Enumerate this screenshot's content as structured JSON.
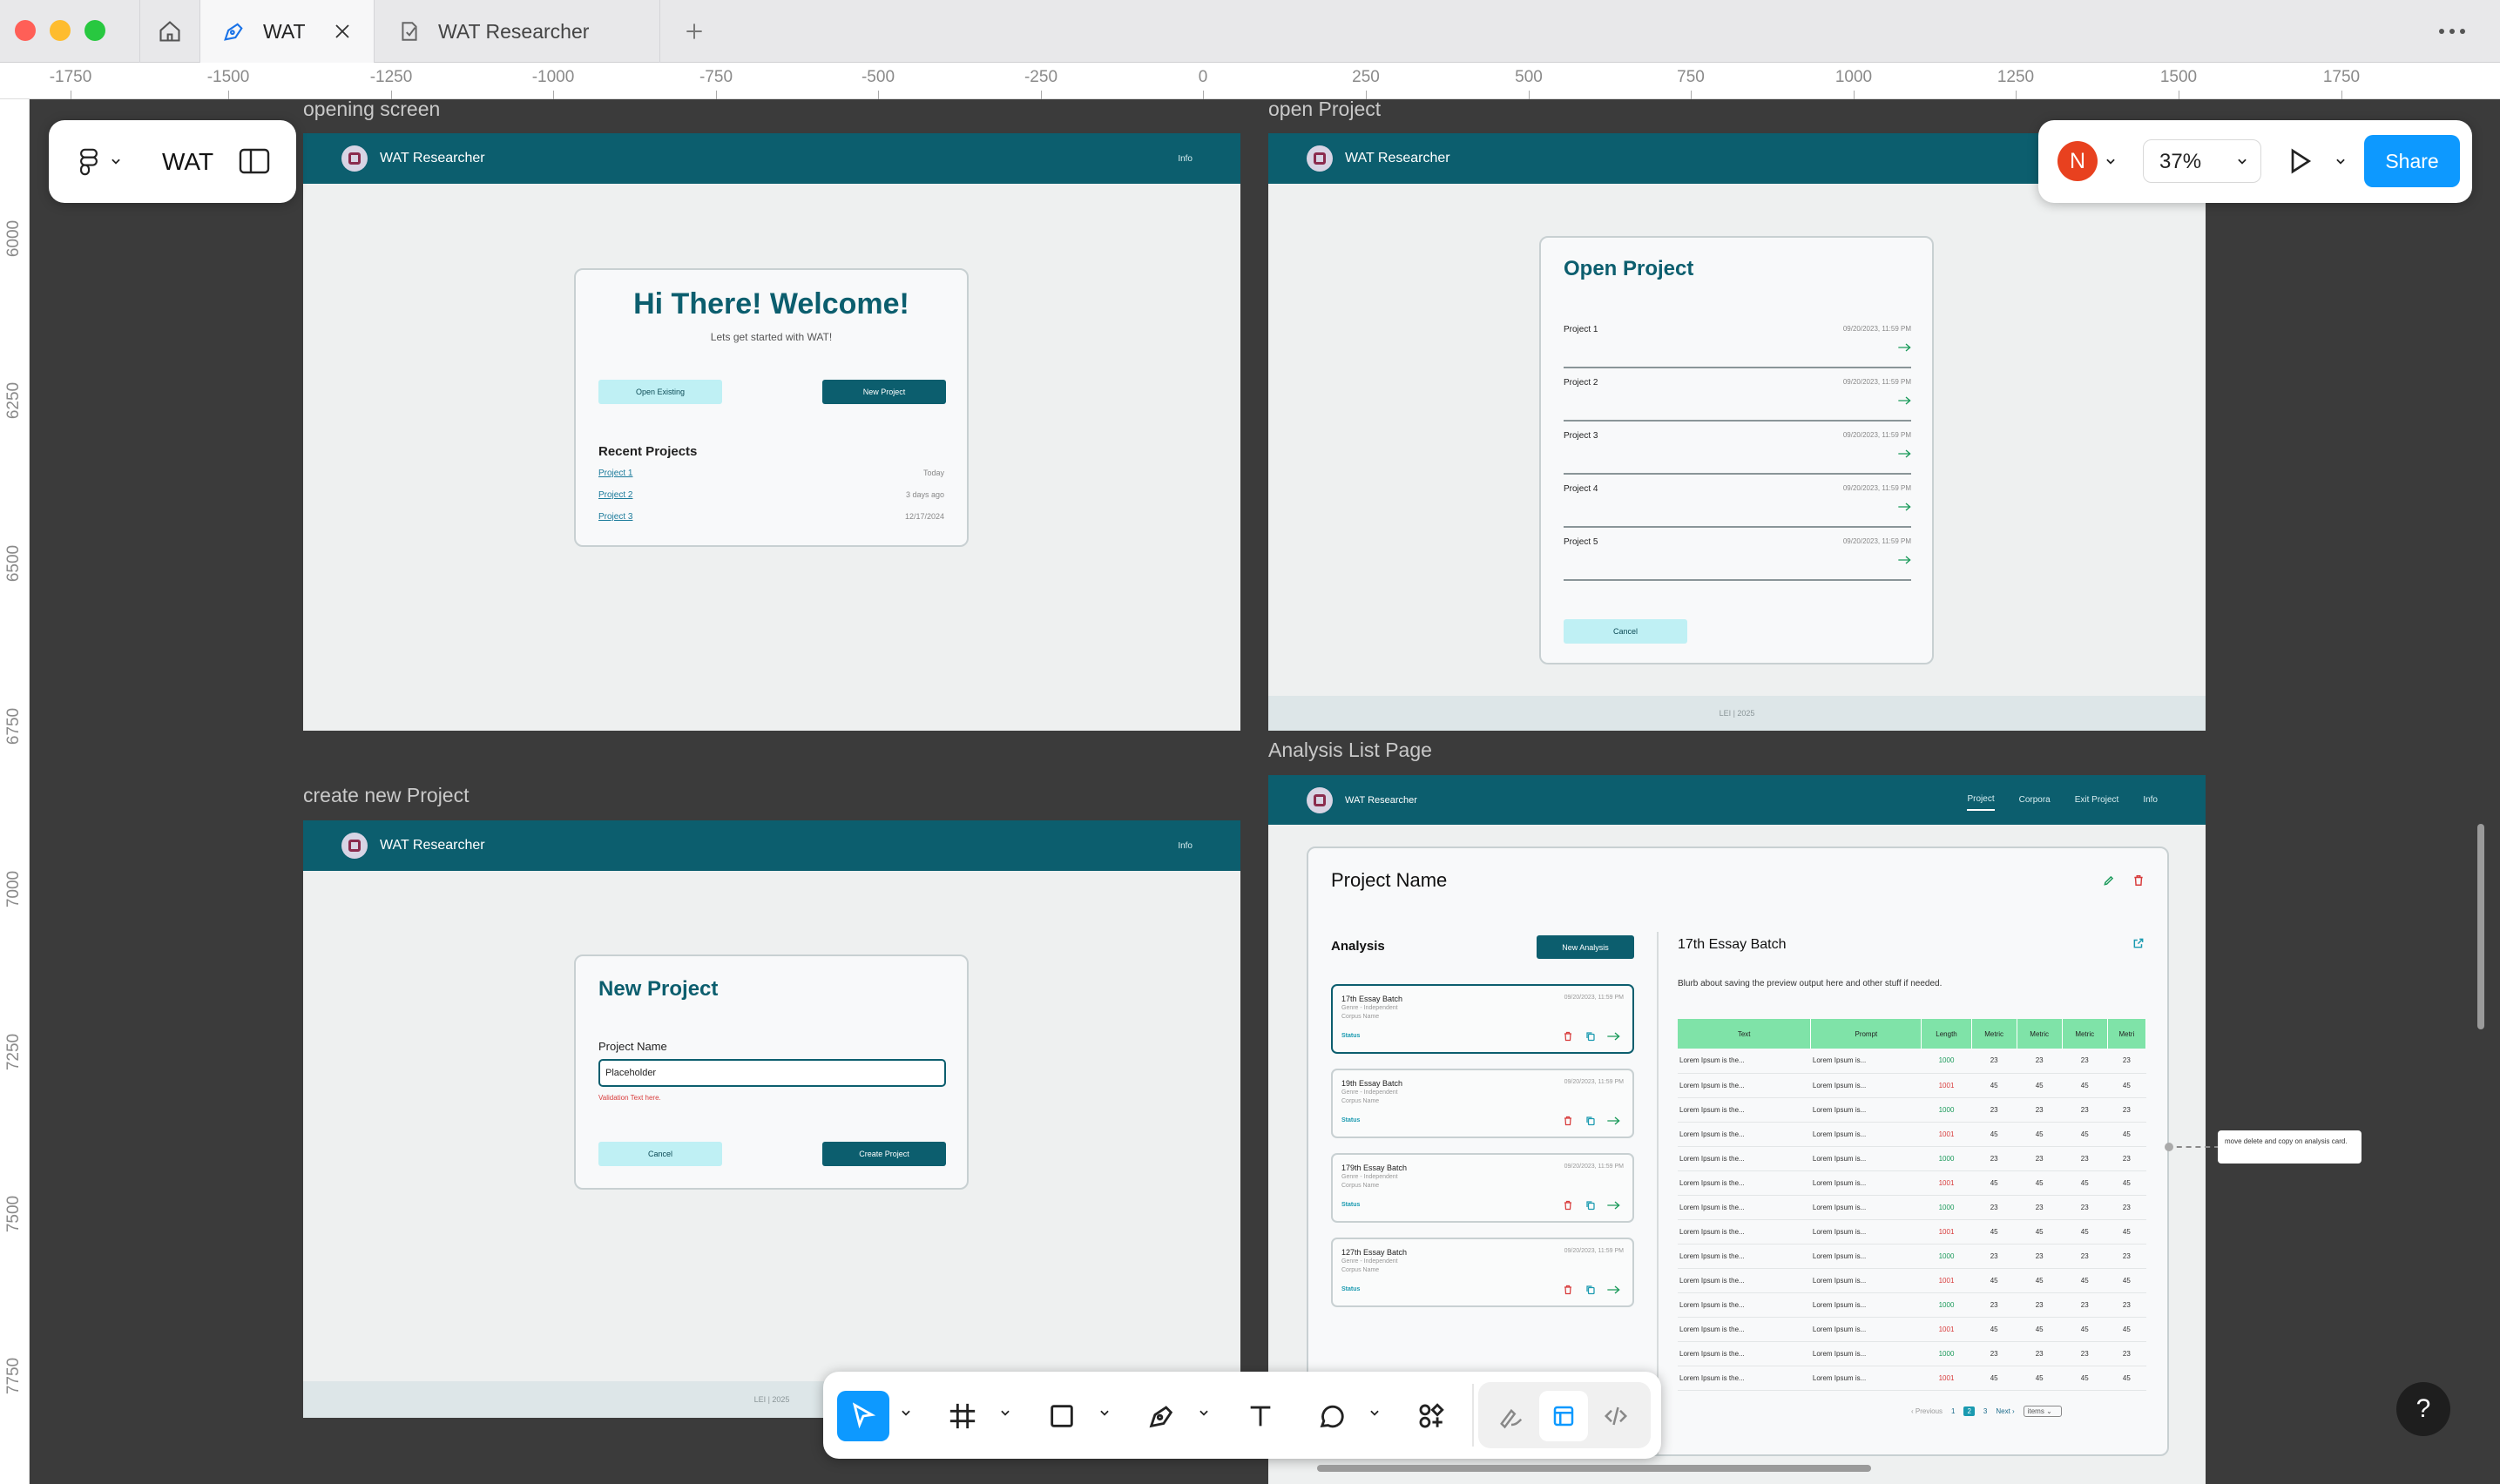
{
  "tabs": [
    {
      "label": "WAT",
      "active": true
    },
    {
      "label": "WAT Researcher",
      "active": false
    }
  ],
  "ruler": {
    "horizontal": [
      "-1750",
      "-1500",
      "-1250",
      "-1000",
      "-750",
      "-500",
      "-250",
      "0",
      "250",
      "500",
      "750",
      "1000",
      "1250",
      "1500",
      "1750"
    ],
    "vertical": [
      "6000",
      "6250",
      "6500",
      "6750",
      "7000",
      "7250",
      "7500",
      "7750"
    ]
  },
  "file": {
    "name": "WAT"
  },
  "share": {
    "avatar_initial": "N",
    "zoom": "37%",
    "share_label": "Share"
  },
  "frames": {
    "opening": {
      "label": "opening screen",
      "app_name": "WAT Researcher",
      "info": "Info",
      "heading": "Hi There! Welcome!",
      "subheading": "Lets get started with WAT!",
      "open_existing": "Open Existing",
      "new_project": "New Project",
      "recent_title": "Recent Projects",
      "recent": [
        {
          "name": "Project 1",
          "date": "Today"
        },
        {
          "name": "Project 2",
          "date": "3 days ago"
        },
        {
          "name": "Project 3",
          "date": "12/17/2024"
        }
      ]
    },
    "open": {
      "label": "open Project",
      "app_name": "WAT Researcher",
      "title": "Open Project",
      "projects": [
        {
          "name": "Project 1",
          "date": "09/20/2023, 11:59 PM"
        },
        {
          "name": "Project 2",
          "date": "09/20/2023, 11:59 PM"
        },
        {
          "name": "Project 3",
          "date": "09/20/2023, 11:59 PM"
        },
        {
          "name": "Project 4",
          "date": "09/20/2023, 11:59 PM"
        },
        {
          "name": "Project 5",
          "date": "09/20/2023, 11:59 PM"
        }
      ],
      "cancel": "Cancel",
      "footer": "LEI | 2025"
    },
    "create": {
      "label": "create new Project",
      "app_name": "WAT Researcher",
      "info": "Info",
      "title": "New Project",
      "field_label": "Project Name",
      "field_value": "Placeholder",
      "validation": "Validation Text here.",
      "cancel": "Cancel",
      "create": "Create Project",
      "footer": "LEI | 2025"
    },
    "analysis": {
      "label": "Analysis List Page",
      "app_name": "WAT Researcher",
      "nav": [
        "Project",
        "Corpora",
        "Exit Project",
        "Info"
      ],
      "project_name": "Project Name",
      "analysis_title": "Analysis",
      "new_analysis": "New Analysis",
      "items": [
        {
          "name": "17th Essay Batch",
          "date": "09/20/2023, 11:59 PM",
          "genre": "Genre - Independent",
          "corpus": "Corpus Name",
          "status": "Status"
        },
        {
          "name": "19th Essay Batch",
          "date": "09/20/2023, 11:59 PM",
          "genre": "Genre - Independent",
          "corpus": "Corpus Name",
          "status": "Status"
        },
        {
          "name": "179th Essay Batch",
          "date": "09/20/2023, 11:59 PM",
          "genre": "Genre - Independent",
          "corpus": "Corpus Name",
          "status": "Status"
        },
        {
          "name": "127th Essay Batch",
          "date": "09/20/2023, 11:59 PM",
          "genre": "Genre - Independent",
          "corpus": "Corpus Name",
          "status": "Status"
        }
      ],
      "preview_title": "17th Essay Batch",
      "blurb": "Blurb about saving the preview output here and other stuff if needed.",
      "columns": [
        "Text",
        "Prompt",
        "Length",
        "Metric",
        "Metric",
        "Metric",
        "Metri"
      ],
      "rows": [
        [
          "Lorem Ipsum is the...",
          "Lorem Ipsum is...",
          "1000",
          "23",
          "23",
          "23",
          "23"
        ],
        [
          "Lorem Ipsum is the...",
          "Lorem Ipsum is...",
          "1001",
          "45",
          "45",
          "45",
          "45"
        ],
        [
          "Lorem Ipsum is the...",
          "Lorem Ipsum is...",
          "1000",
          "23",
          "23",
          "23",
          "23"
        ],
        [
          "Lorem Ipsum is the...",
          "Lorem Ipsum is...",
          "1001",
          "45",
          "45",
          "45",
          "45"
        ],
        [
          "Lorem Ipsum is the...",
          "Lorem Ipsum is...",
          "1000",
          "23",
          "23",
          "23",
          "23"
        ],
        [
          "Lorem Ipsum is the...",
          "Lorem Ipsum is...",
          "1001",
          "45",
          "45",
          "45",
          "45"
        ],
        [
          "Lorem Ipsum is the...",
          "Lorem Ipsum is...",
          "1000",
          "23",
          "23",
          "23",
          "23"
        ],
        [
          "Lorem Ipsum is the...",
          "Lorem Ipsum is...",
          "1001",
          "45",
          "45",
          "45",
          "45"
        ],
        [
          "Lorem Ipsum is the...",
          "Lorem Ipsum is...",
          "1000",
          "23",
          "23",
          "23",
          "23"
        ],
        [
          "Lorem Ipsum is the...",
          "Lorem Ipsum is...",
          "1001",
          "45",
          "45",
          "45",
          "45"
        ],
        [
          "Lorem Ipsum is the...",
          "Lorem Ipsum is...",
          "1000",
          "23",
          "23",
          "23",
          "23"
        ],
        [
          "Lorem Ipsum is the...",
          "Lorem Ipsum is...",
          "1001",
          "45",
          "45",
          "45",
          "45"
        ],
        [
          "Lorem Ipsum is the...",
          "Lorem Ipsum is...",
          "1000",
          "23",
          "23",
          "23",
          "23"
        ],
        [
          "Lorem Ipsum is the...",
          "Lorem Ipsum is...",
          "1001",
          "45",
          "45",
          "45",
          "45"
        ]
      ],
      "pagination": {
        "previous": "Previous",
        "pages": [
          "1",
          "2",
          "3"
        ],
        "current": "2",
        "next": "Next",
        "items_label": "items"
      },
      "annotation": "move delete and copy on analysis card."
    }
  },
  "colors": {
    "brand_teal": "#0c5e6e",
    "figma_blue": "#0d99ff",
    "length_green": "#1a9a5a",
    "length_red": "#d83b3b"
  }
}
